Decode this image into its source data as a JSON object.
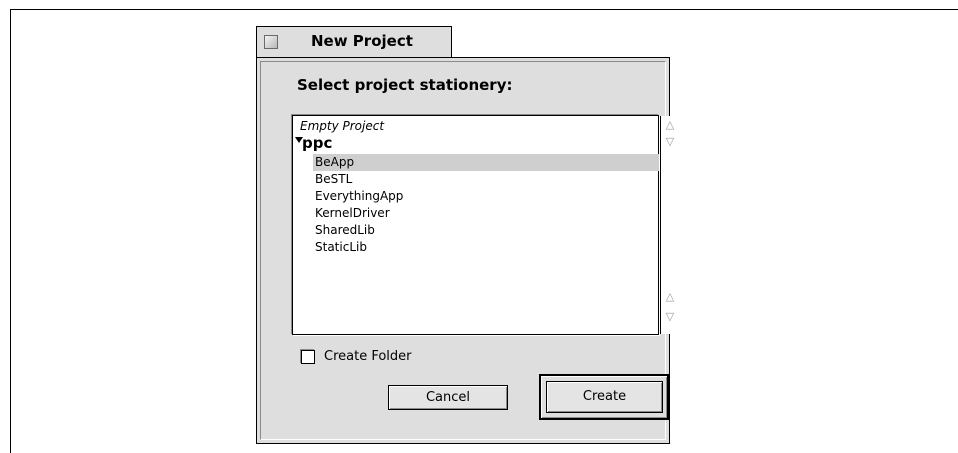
{
  "dialog": {
    "tab_title": "New Project",
    "heading": "Select project stationery:"
  },
  "list": {
    "rows": [
      {
        "label": "Empty Project",
        "style": "italic",
        "selected": false
      },
      {
        "label": "ppc",
        "style": "group",
        "selected": false
      },
      {
        "label": "BeApp",
        "style": "item",
        "selected": true
      },
      {
        "label": "BeSTL",
        "style": "item",
        "selected": false
      },
      {
        "label": "EverythingApp",
        "style": "item",
        "selected": false
      },
      {
        "label": "KernelDriver",
        "style": "item",
        "selected": false
      },
      {
        "label": "SharedLib",
        "style": "item",
        "selected": false
      },
      {
        "label": "StaticLib",
        "style": "item",
        "selected": false
      }
    ]
  },
  "options": {
    "create_folder_label": "Create Folder",
    "create_folder_checked": false
  },
  "buttons": {
    "cancel_label": "Cancel",
    "create_label": "Create"
  },
  "colors": {
    "window_bg": "#dedede",
    "selection": "#cfcfcf"
  },
  "icons": {
    "zoom_box": "zoom-box-icon",
    "disclosure": "disclosure-triangle-down-icon",
    "scroll_up": "scroll-up-arrow-icon",
    "scroll_down": "scroll-down-arrow-icon"
  }
}
